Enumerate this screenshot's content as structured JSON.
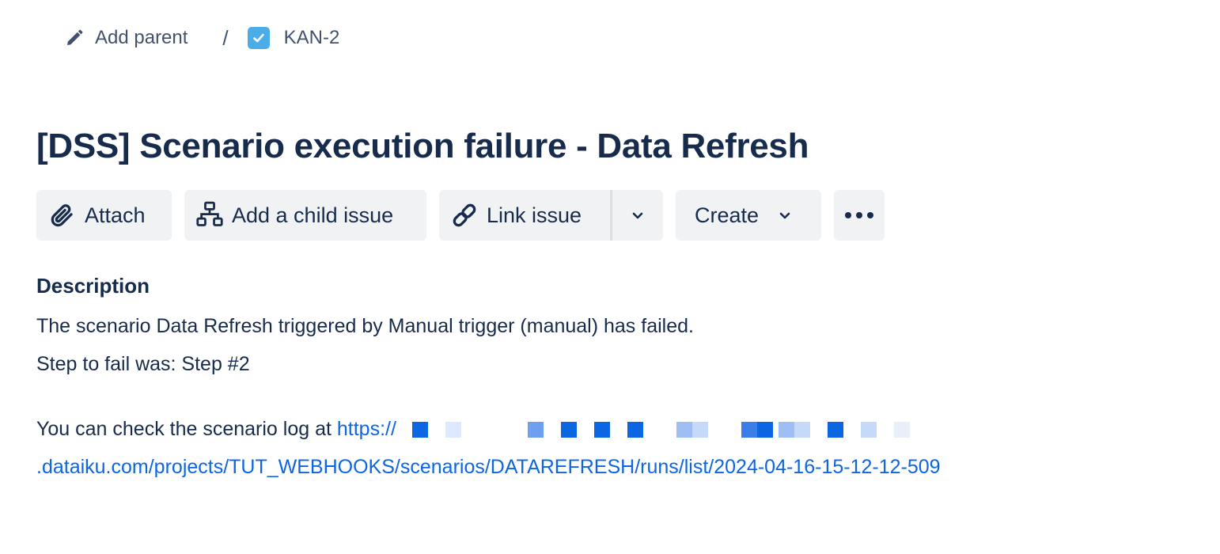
{
  "breadcrumb": {
    "add_parent": "Add parent",
    "separator": "/",
    "issue_key": "KAN-2"
  },
  "issue": {
    "title": "[DSS] Scenario execution failure - Data Refresh"
  },
  "toolbar": {
    "attach": "Attach",
    "add_child": "Add a child issue",
    "link_issue": "Link issue",
    "create": "Create"
  },
  "description": {
    "heading": "Description",
    "line1": "The scenario Data Refresh triggered by Manual trigger (manual) has failed.",
    "line2": "Step to fail was: Step #2",
    "log_prefix": "You can check the scenario log at ",
    "link_start": "https://",
    "link_end": ".dataiku.com/projects/TUT_WEBHOOKS/scenarios/DATAREFRESH/runs/list/2024-04-16-15-12-12-509"
  },
  "icons": {
    "add_parent": "pencil-icon",
    "issue_type": "checkbox-task-icon",
    "attach": "paperclip-icon",
    "add_child": "hierarchy-icon",
    "link_issue": "link-icon",
    "link_dropdown": "chevron-down-icon",
    "create_dropdown": "chevron-down-icon",
    "more": "more-horizontal-icon"
  },
  "colors": {
    "text": "#172b4d",
    "subtle_text": "#42526e",
    "link": "#0c66e4",
    "button_bg": "#f1f2f4",
    "task_icon": "#4bade8"
  }
}
